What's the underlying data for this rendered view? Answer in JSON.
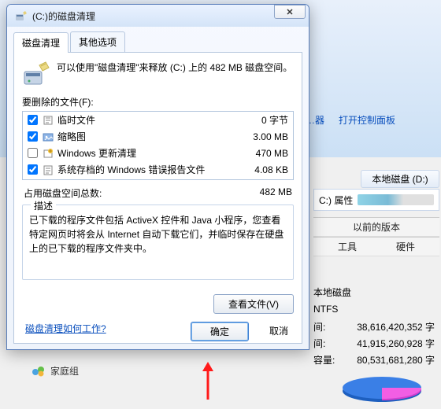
{
  "dialog": {
    "title": "(C:)的磁盘清理",
    "tabs": [
      "磁盘清理",
      "其他选项"
    ],
    "intro": "可以使用\"磁盘清理\"来释放  (C:) 上的 482 MB 磁盘空间。",
    "delete_label": "要删除的文件(F):",
    "files": [
      {
        "checked": true,
        "name": "临时文件",
        "size": "0 字节"
      },
      {
        "checked": true,
        "name": "缩略图",
        "size": "3.00 MB"
      },
      {
        "checked": false,
        "name": "Windows 更新清理",
        "size": "470 MB"
      },
      {
        "checked": true,
        "name": "系统存档的 Windows 错误报告文件",
        "size": "4.08 KB"
      }
    ],
    "total_label": "占用磁盘空间总数:",
    "total_value": "482 MB",
    "desc_legend": "描述",
    "desc_body": "已下载的程序文件包括 ActiveX 控件和 Java 小程序，您查看特定网页时将会从 Internet 自动下载它们，并临时保存在硬盘上的已下载的程序文件夹中。",
    "view_files_btn": "查看文件(V)",
    "help_link": "磁盘清理如何工作?",
    "ok_btn": "确定",
    "cancel_btn": "取消"
  },
  "background": {
    "top_links": {
      "l1": "…器",
      "l2": "打开控制面板"
    },
    "local_disk_header": "本地磁盘 (D:)",
    "props_label": "C:) 属性",
    "prev_versions": "以前的版本",
    "tabs2": [
      "工具",
      "硬件"
    ],
    "fs_type_label": "本地磁盘",
    "fs_value": "NTFS",
    "stats": [
      {
        "k": "间:",
        "v": "38,616,420,352  字"
      },
      {
        "k": "间:",
        "v": "41,915,260,928  字"
      },
      {
        "k": "容量:",
        "v": "80,531,681,280  字"
      }
    ],
    "homegroup": "家庭组"
  }
}
